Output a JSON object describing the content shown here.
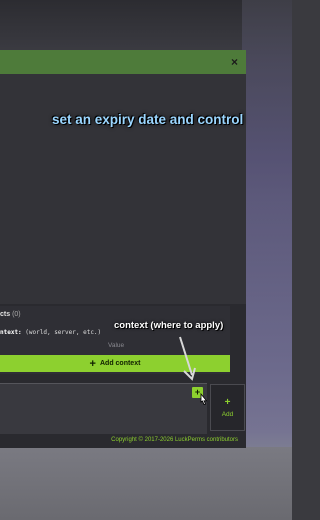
{
  "modal": {
    "close_label": "×"
  },
  "captions": {
    "top": "set an expiry date and control",
    "context": "context (where to apply)"
  },
  "context_section": {
    "title_partial": "cts",
    "count": "(0)",
    "hint_key": "ntext:",
    "hint_text": " (world, server, etc.)",
    "value_label": "Value",
    "add_button_label": "Add context"
  },
  "actions": {
    "small_add_icon": "+",
    "add_button_label": "Add"
  },
  "footer": {
    "copyright": "Copyright © 2017-2026 LuckPerms contributors"
  },
  "colors": {
    "accent_green": "#8dd02f",
    "header_green": "#4e7b3a",
    "caption_blue": "#9bd6ff"
  }
}
